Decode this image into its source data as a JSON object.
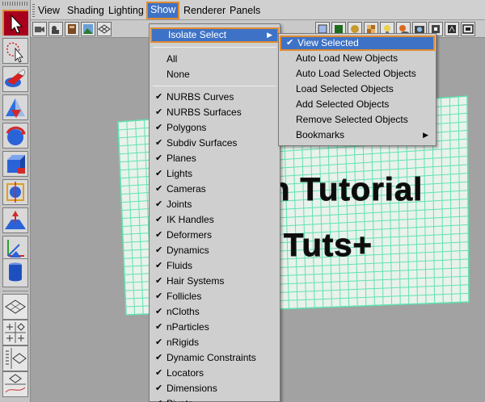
{
  "menubar": {
    "items": [
      "View",
      "Shading",
      "Lighting",
      "Show",
      "Renderer",
      "Panels"
    ],
    "open_item": "Show"
  },
  "show_menu": {
    "isolate_select": "Isolate Select",
    "all": "All",
    "none": "None",
    "items": [
      {
        "label": "NURBS Curves",
        "checked": true
      },
      {
        "label": "NURBS Surfaces",
        "checked": true
      },
      {
        "label": "Polygons",
        "checked": true
      },
      {
        "label": "Subdiv Surfaces",
        "checked": true
      },
      {
        "label": "Planes",
        "checked": true
      },
      {
        "label": "Lights",
        "checked": true
      },
      {
        "label": "Cameras",
        "checked": true
      },
      {
        "label": "Joints",
        "checked": true
      },
      {
        "label": "IK Handles",
        "checked": true
      },
      {
        "label": "Deformers",
        "checked": true
      },
      {
        "label": "Dynamics",
        "checked": true
      },
      {
        "label": "Fluids",
        "checked": true
      },
      {
        "label": "Hair Systems",
        "checked": true
      },
      {
        "label": "Follicles",
        "checked": true
      },
      {
        "label": "nCloths",
        "checked": true
      },
      {
        "label": "nParticles",
        "checked": true
      },
      {
        "label": "nRigids",
        "checked": true
      },
      {
        "label": "Dynamic Constraints",
        "checked": true
      },
      {
        "label": "Locators",
        "checked": true
      },
      {
        "label": "Dimensions",
        "checked": true
      },
      {
        "label": "Pivots",
        "checked": true
      }
    ]
  },
  "isolate_submenu": {
    "items": [
      {
        "label": "View Selected",
        "checked": true
      },
      {
        "label": "Auto Load New Objects",
        "checked": false
      },
      {
        "label": "Auto Load Selected Objects",
        "checked": false
      },
      {
        "label": "Load Selected Objects",
        "checked": false
      },
      {
        "label": "Add Selected Objects",
        "checked": false
      },
      {
        "label": "Remove Selected Objects",
        "checked": false
      },
      {
        "label": "Bookmarks",
        "checked": false,
        "submenu": true
      }
    ]
  },
  "viewport": {
    "text_line1": "n Tutorial",
    "text_line2": "Tuts+"
  },
  "colors": {
    "highlight": "#3d72c6",
    "highlight_border": "#e08a2e",
    "mesh": "#5fe3b0",
    "viewport_bg": "#a2a2a2"
  },
  "icons": {
    "check": "✔",
    "submenu_arrow": "▶"
  }
}
